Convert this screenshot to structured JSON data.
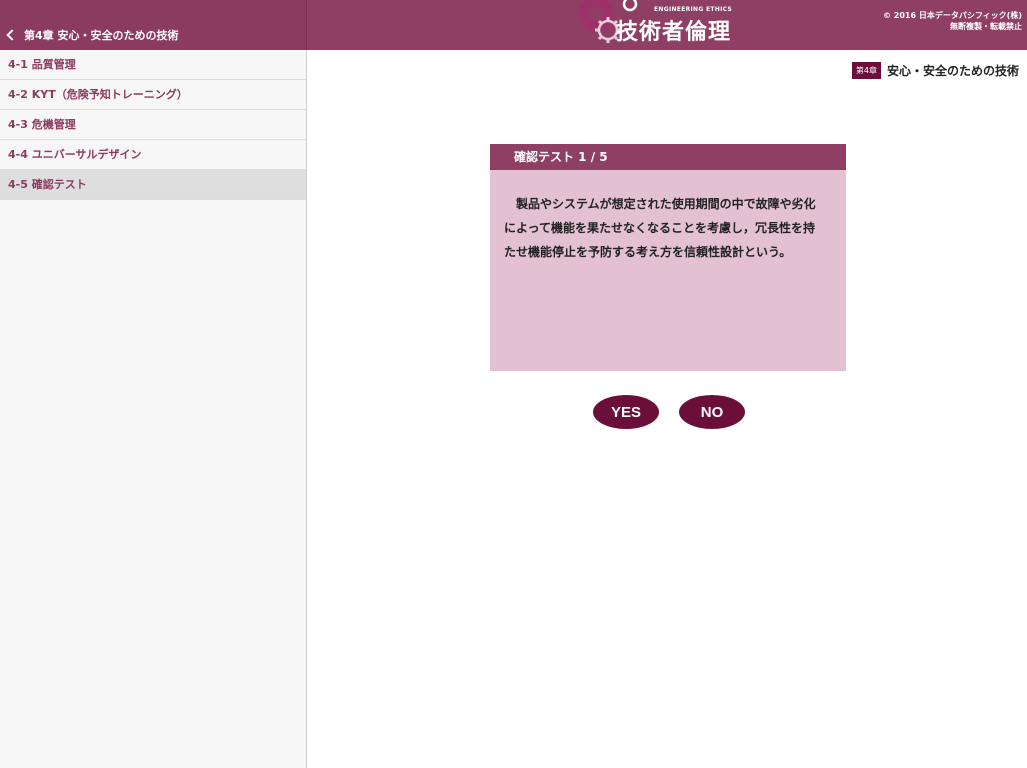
{
  "header": {
    "back_label": "第4章 安心・安全のための技術",
    "logo_tagline": "ENGINEERING ETHICS",
    "logo_title": "技術者倫理",
    "copyright_line1": "© 2016 日本データパシフィック(株)",
    "copyright_line2": "無断複製・転載禁止",
    "color": "#8e3f63"
  },
  "sidebar": {
    "items": [
      {
        "label": "4-1 品質管理",
        "active": false
      },
      {
        "label": "4-2 KYT（危険予知トレーニング）",
        "active": false
      },
      {
        "label": "4-3 危機管理",
        "active": false
      },
      {
        "label": "4-4 ユニバーサルデザイン",
        "active": false
      },
      {
        "label": "4-5 確認テスト",
        "active": true
      }
    ]
  },
  "chapter": {
    "badge": "第4章",
    "title": "安心・安全のための技術"
  },
  "quiz": {
    "header": "確認テスト 1 / 5",
    "question": "製品やシステムが想定された使用期間の中で故障や劣化によって機能を果たせなくなることを考慮し，冗長性を持たせ機能停止を予防する考え方を信頼性設計という。",
    "yes_label": "YES",
    "no_label": "NO",
    "accent_color": "#6b0f3a",
    "panel_color": "#e3c1d2"
  }
}
